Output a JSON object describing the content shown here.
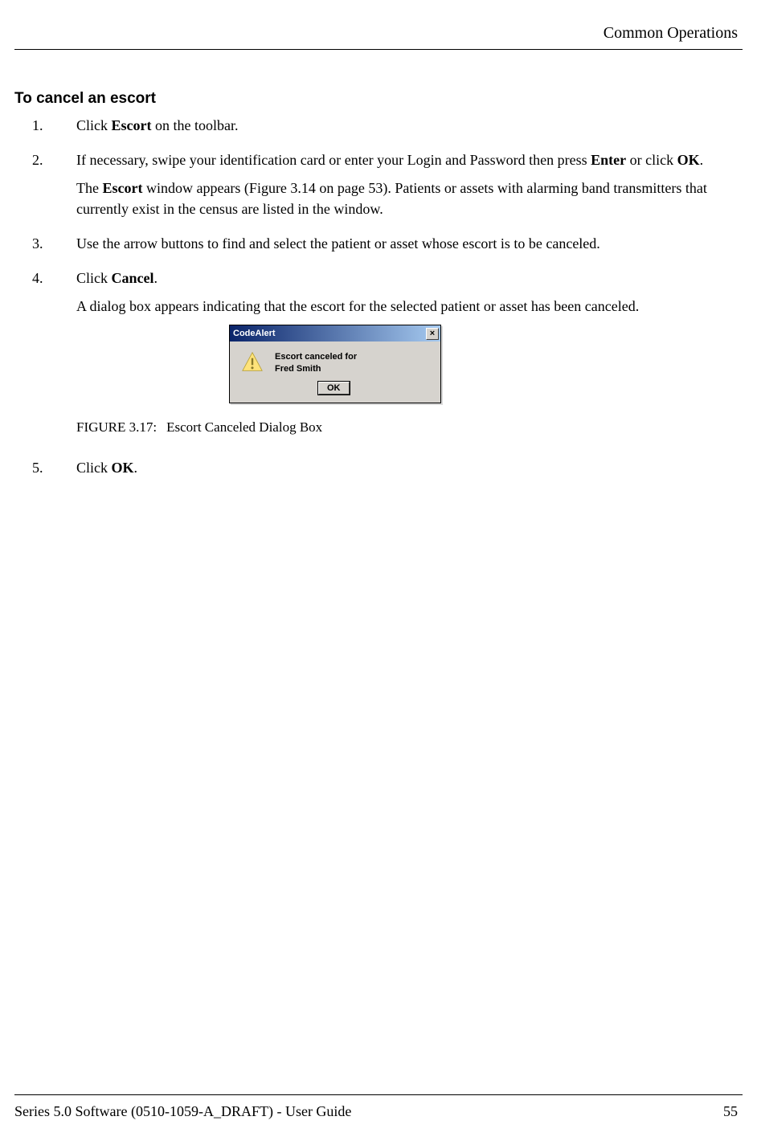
{
  "header": {
    "section": "Common Operations"
  },
  "heading": "To cancel an escort",
  "steps": [
    {
      "num": "1.",
      "parts": [
        {
          "t": "Click ",
          "b": false
        },
        {
          "t": "Escort",
          "b": true
        },
        {
          "t": " on the toolbar.",
          "b": false
        }
      ]
    },
    {
      "num": "2.",
      "parts": [
        {
          "t": "If necessary, swipe your identification card or enter your Login and Password then press ",
          "b": false
        },
        {
          "t": "Enter",
          "b": true
        },
        {
          "t": " or click ",
          "b": false
        },
        {
          "t": "OK",
          "b": true
        },
        {
          "t": ".",
          "b": false
        }
      ],
      "extra": [
        {
          "t": "The ",
          "b": false
        },
        {
          "t": "Escort",
          "b": true
        },
        {
          "t": " window appears (Figure 3.14 on page 53). Patients or assets with alarming band transmitters that currently exist in the census are listed in the window.",
          "b": false
        }
      ]
    },
    {
      "num": "3.",
      "parts": [
        {
          "t": "Use the arrow buttons to find and select the patient or asset whose escort is to be canceled.",
          "b": false
        }
      ]
    },
    {
      "num": "4.",
      "parts": [
        {
          "t": "Click ",
          "b": false
        },
        {
          "t": "Cancel",
          "b": true
        },
        {
          "t": ".",
          "b": false
        }
      ],
      "after": [
        {
          "t": "A dialog box appears indicating that the escort for the selected patient or asset has been canceled.",
          "b": false
        }
      ]
    },
    {
      "num": "5.",
      "parts": [
        {
          "t": "Click ",
          "b": false
        },
        {
          "t": "OK",
          "b": true
        },
        {
          "t": ".",
          "b": false
        }
      ]
    }
  ],
  "dialog": {
    "title": "CodeAlert",
    "close": "×",
    "line1": "Escort canceled for",
    "line2": "Fred Smith",
    "ok": "OK"
  },
  "figure": {
    "label": "FIGURE 3.17:",
    "caption": "Escort Canceled Dialog Box"
  },
  "footer": {
    "left": "Series 5.0 Software (0510-1059-A_DRAFT) - User Guide",
    "right": "55"
  }
}
